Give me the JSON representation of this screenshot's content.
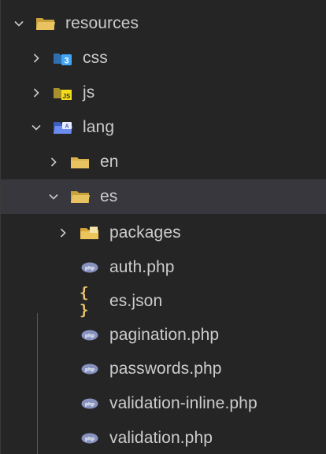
{
  "explorer": {
    "items": [
      {
        "label": "resources",
        "kind": "folder",
        "expanded": true
      },
      {
        "label": "css",
        "kind": "css-folder",
        "expanded": false
      },
      {
        "label": "js",
        "kind": "js-folder",
        "expanded": false
      },
      {
        "label": "lang",
        "kind": "lang-folder",
        "expanded": true
      },
      {
        "label": "en",
        "kind": "folder",
        "expanded": false
      },
      {
        "label": "es",
        "kind": "folder",
        "expanded": true,
        "selected": true
      },
      {
        "label": "packages",
        "kind": "package-folder",
        "expanded": false
      },
      {
        "label": "auth.php",
        "kind": "php-file"
      },
      {
        "label": "es.json",
        "kind": "json-file",
        "icon_glyph": "{ }"
      },
      {
        "label": "pagination.php",
        "kind": "php-file"
      },
      {
        "label": "passwords.php",
        "kind": "php-file"
      },
      {
        "label": "validation-inline.php",
        "kind": "php-file"
      },
      {
        "label": "validation.php",
        "kind": "php-file"
      }
    ]
  },
  "colors": {
    "background": "#252526",
    "selected_row": "#37373d",
    "folder": "#d9b34a",
    "css_badge": "#42a5f5",
    "js_badge": "#f5de19",
    "lang_badge": "#6d8cf0",
    "php_icon": "#8892bf",
    "json_icon": "#e9c46a"
  }
}
